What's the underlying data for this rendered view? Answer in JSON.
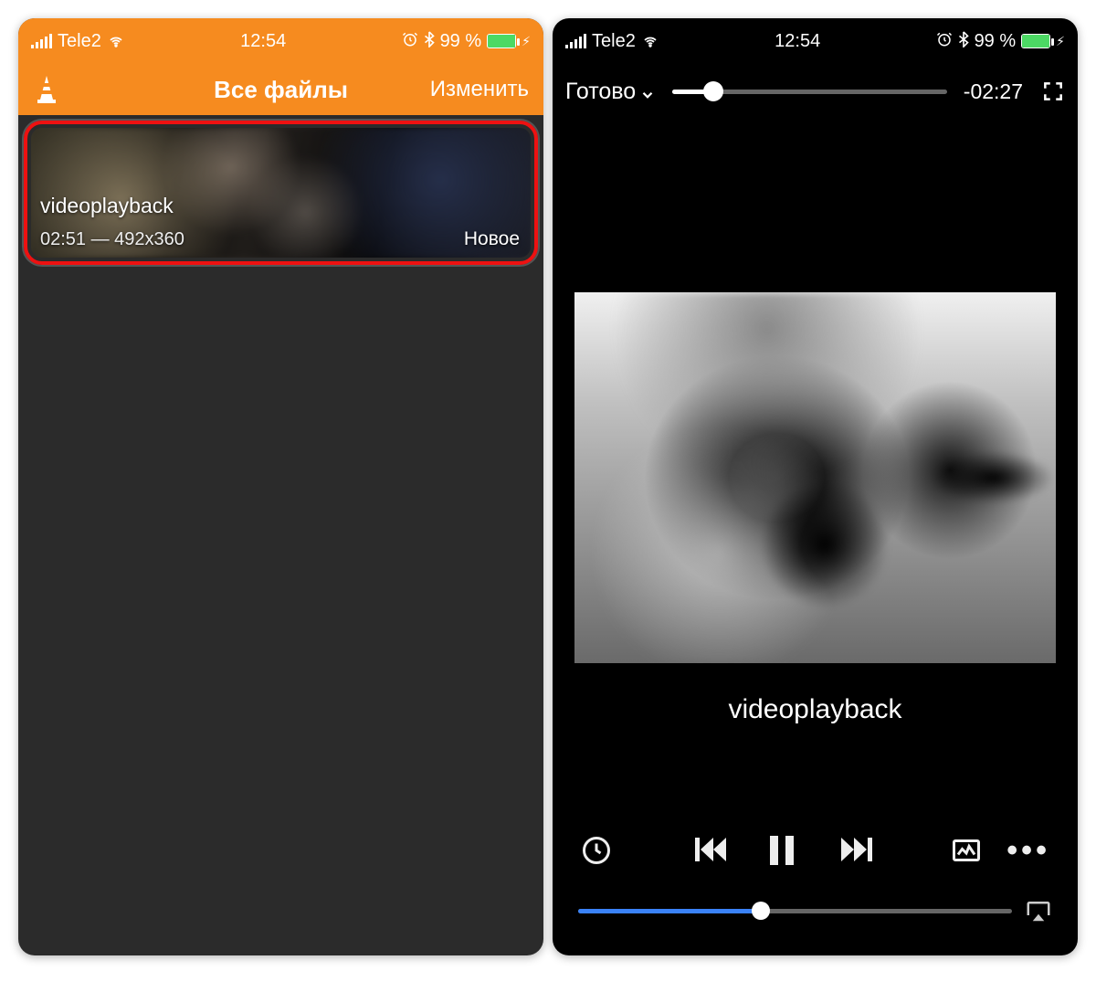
{
  "status": {
    "carrier": "Tele2",
    "time": "12:54",
    "battery_pct": "99 %",
    "battery_fill_pct": 99
  },
  "left": {
    "nav_title": "Все файлы",
    "nav_edit": "Изменить",
    "item": {
      "title": "videoplayback",
      "meta": "02:51 — 492x360",
      "badge": "Новое"
    }
  },
  "right": {
    "done": "Готово",
    "remaining": "-02:27",
    "seek_progress_pct": 15,
    "video_title": "videoplayback",
    "bottom_seek_pct": 42
  },
  "icons": {
    "cone": "vlc-cone-icon",
    "wifi": "wifi-icon",
    "bluetooth": "bluetooth-icon",
    "alarm": "alarm-icon",
    "bolt": "bolt-icon",
    "chevron_down": "chevron-down-icon",
    "expand": "expand-icon",
    "clock": "clock-icon",
    "prev": "skip-back-icon",
    "pause": "pause-icon",
    "next": "skip-forward-icon",
    "effects": "effects-icon",
    "more": "more-icon",
    "airplay": "airplay-icon"
  }
}
